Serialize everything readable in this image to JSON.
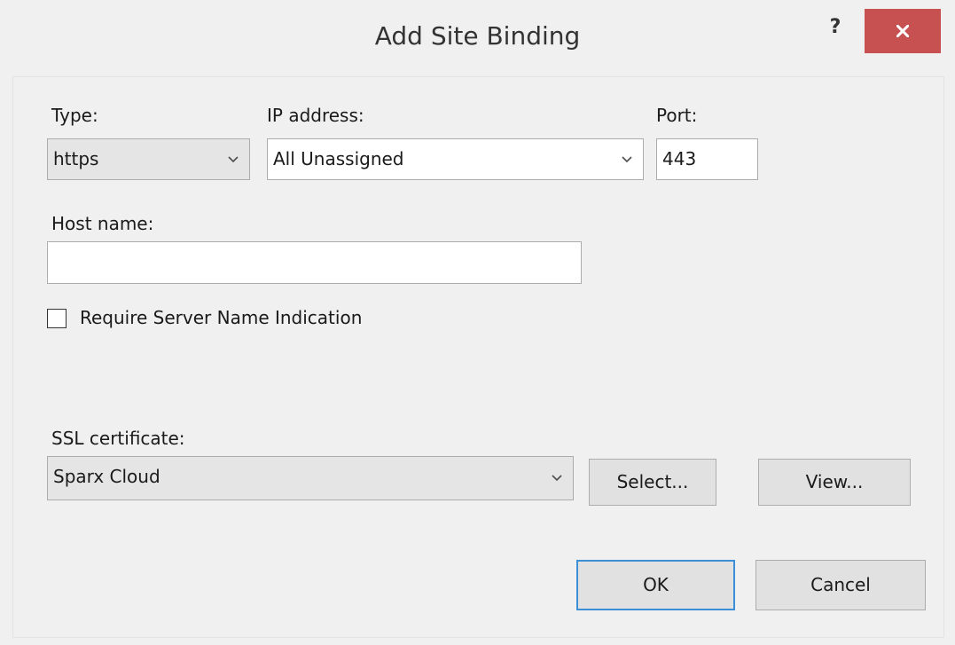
{
  "window": {
    "title": "Add Site Binding",
    "help_label": "?",
    "close_icon": "close-icon"
  },
  "type": {
    "label": "Type:",
    "value": "https"
  },
  "ip": {
    "label": "IP address:",
    "value": "All Unassigned"
  },
  "port": {
    "label": "Port:",
    "value": "443"
  },
  "host": {
    "label": "Host name:",
    "value": ""
  },
  "sni": {
    "label": "Require Server Name Indication",
    "checked": false
  },
  "ssl": {
    "label": "SSL certificate:",
    "value": "Sparx Cloud",
    "select_label": "Select...",
    "view_label": "View..."
  },
  "footer": {
    "ok_label": "OK",
    "cancel_label": "Cancel"
  },
  "colors": {
    "close_button": "#c75050",
    "default_button_border": "#3c8fd6",
    "dialog_background": "#f0f0f0"
  }
}
